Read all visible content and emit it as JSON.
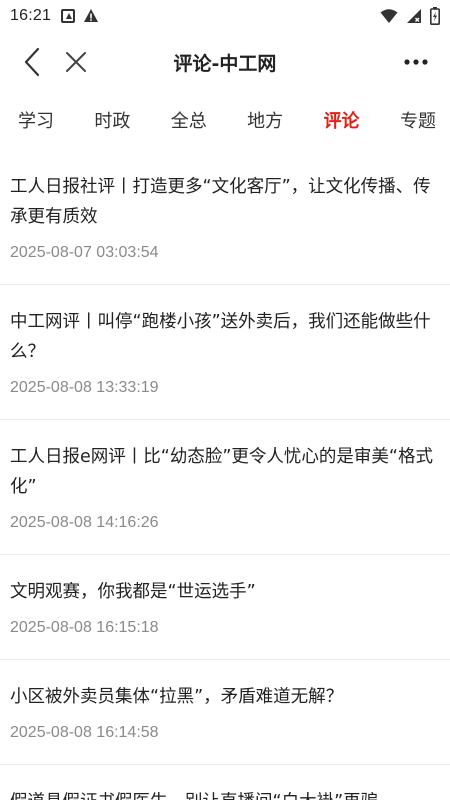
{
  "status_bar": {
    "time": "16:21",
    "icons": [
      "app-notification-icon",
      "warning-icon",
      "wifi-icon",
      "signal-icon",
      "battery-icon"
    ]
  },
  "header": {
    "title": "评论-中工网",
    "back_icon": "chevron-left-icon",
    "close_icon": "close-icon",
    "more_icon": "more-horizontal-icon"
  },
  "tabs": [
    {
      "label": "学习",
      "active": false
    },
    {
      "label": "时政",
      "active": false
    },
    {
      "label": "全总",
      "active": false
    },
    {
      "label": "地方",
      "active": false
    },
    {
      "label": "评论",
      "active": true
    },
    {
      "label": "专题",
      "active": false
    }
  ],
  "news": [
    {
      "title": "工人日报社评丨打造更多“文化客厅”，让文化传播、传承更有质效",
      "time": "2025-08-07 03:03:54"
    },
    {
      "title": "中工网评丨叫停“跑楼小孩”送外卖后，我们还能做些什么？",
      "time": "2025-08-08 13:33:19"
    },
    {
      "title": "工人日报e网评丨比“幼态脸”更令人忧心的是审美“格式化”",
      "time": "2025-08-08 14:16:26"
    },
    {
      "title": "文明观赛，你我都是“世运选手”",
      "time": "2025-08-08 16:15:18"
    },
    {
      "title": "小区被外卖员集体“拉黑”，矛盾难道无解？",
      "time": "2025-08-08 16:14:58"
    },
    {
      "title": "假道具假证书假医生，别让直播间“白大褂”再骗",
      "time": ""
    }
  ],
  "colors": {
    "accent": "#e0211a",
    "text": "#222222",
    "muted": "#8a8a8a",
    "divider": "#ececec"
  }
}
